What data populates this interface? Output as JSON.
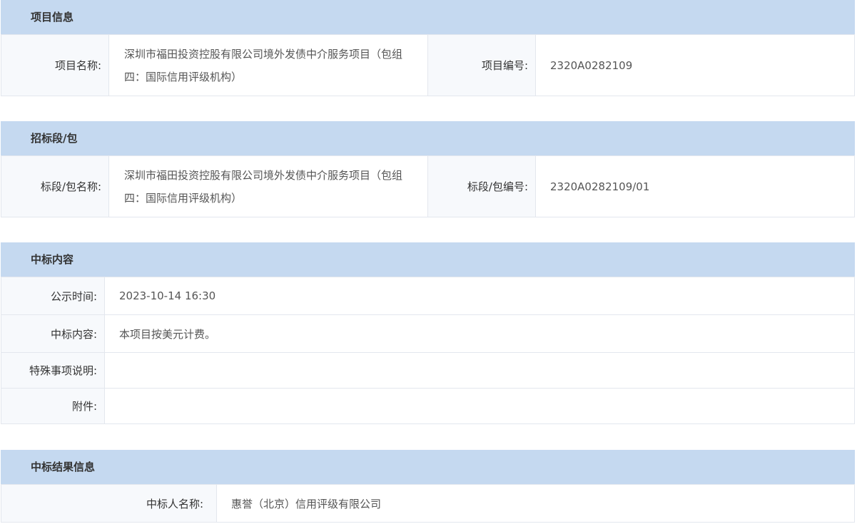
{
  "sections": {
    "project": {
      "title": "项目信息",
      "name_label": "项目名称:",
      "name_value": "深圳市福田投资控股有限公司境外发债中介服务项目（包组四：国际信用评级机构）",
      "code_label": "项目编号:",
      "code_value": "2320A0282109"
    },
    "lot": {
      "title": "招标段/包",
      "name_label": "标段/包名称:",
      "name_value": "深圳市福田投资控股有限公司境外发债中介服务项目（包组四：国际信用评级机构）",
      "code_label": "标段/包编号:",
      "code_value": "2320A0282109/01"
    },
    "award": {
      "title": "中标内容",
      "rows": [
        {
          "label": "公示时间:",
          "value": "2023-10-14 16:30"
        },
        {
          "label": "中标内容:",
          "value": "本项目按美元计费。"
        },
        {
          "label": "特殊事项说明:",
          "value": ""
        },
        {
          "label": "附件:",
          "value": ""
        }
      ]
    },
    "result": {
      "title": "中标结果信息",
      "winner_label": "中标人名称:",
      "winner_value": "惠誉（北京）信用评级有限公司"
    }
  }
}
